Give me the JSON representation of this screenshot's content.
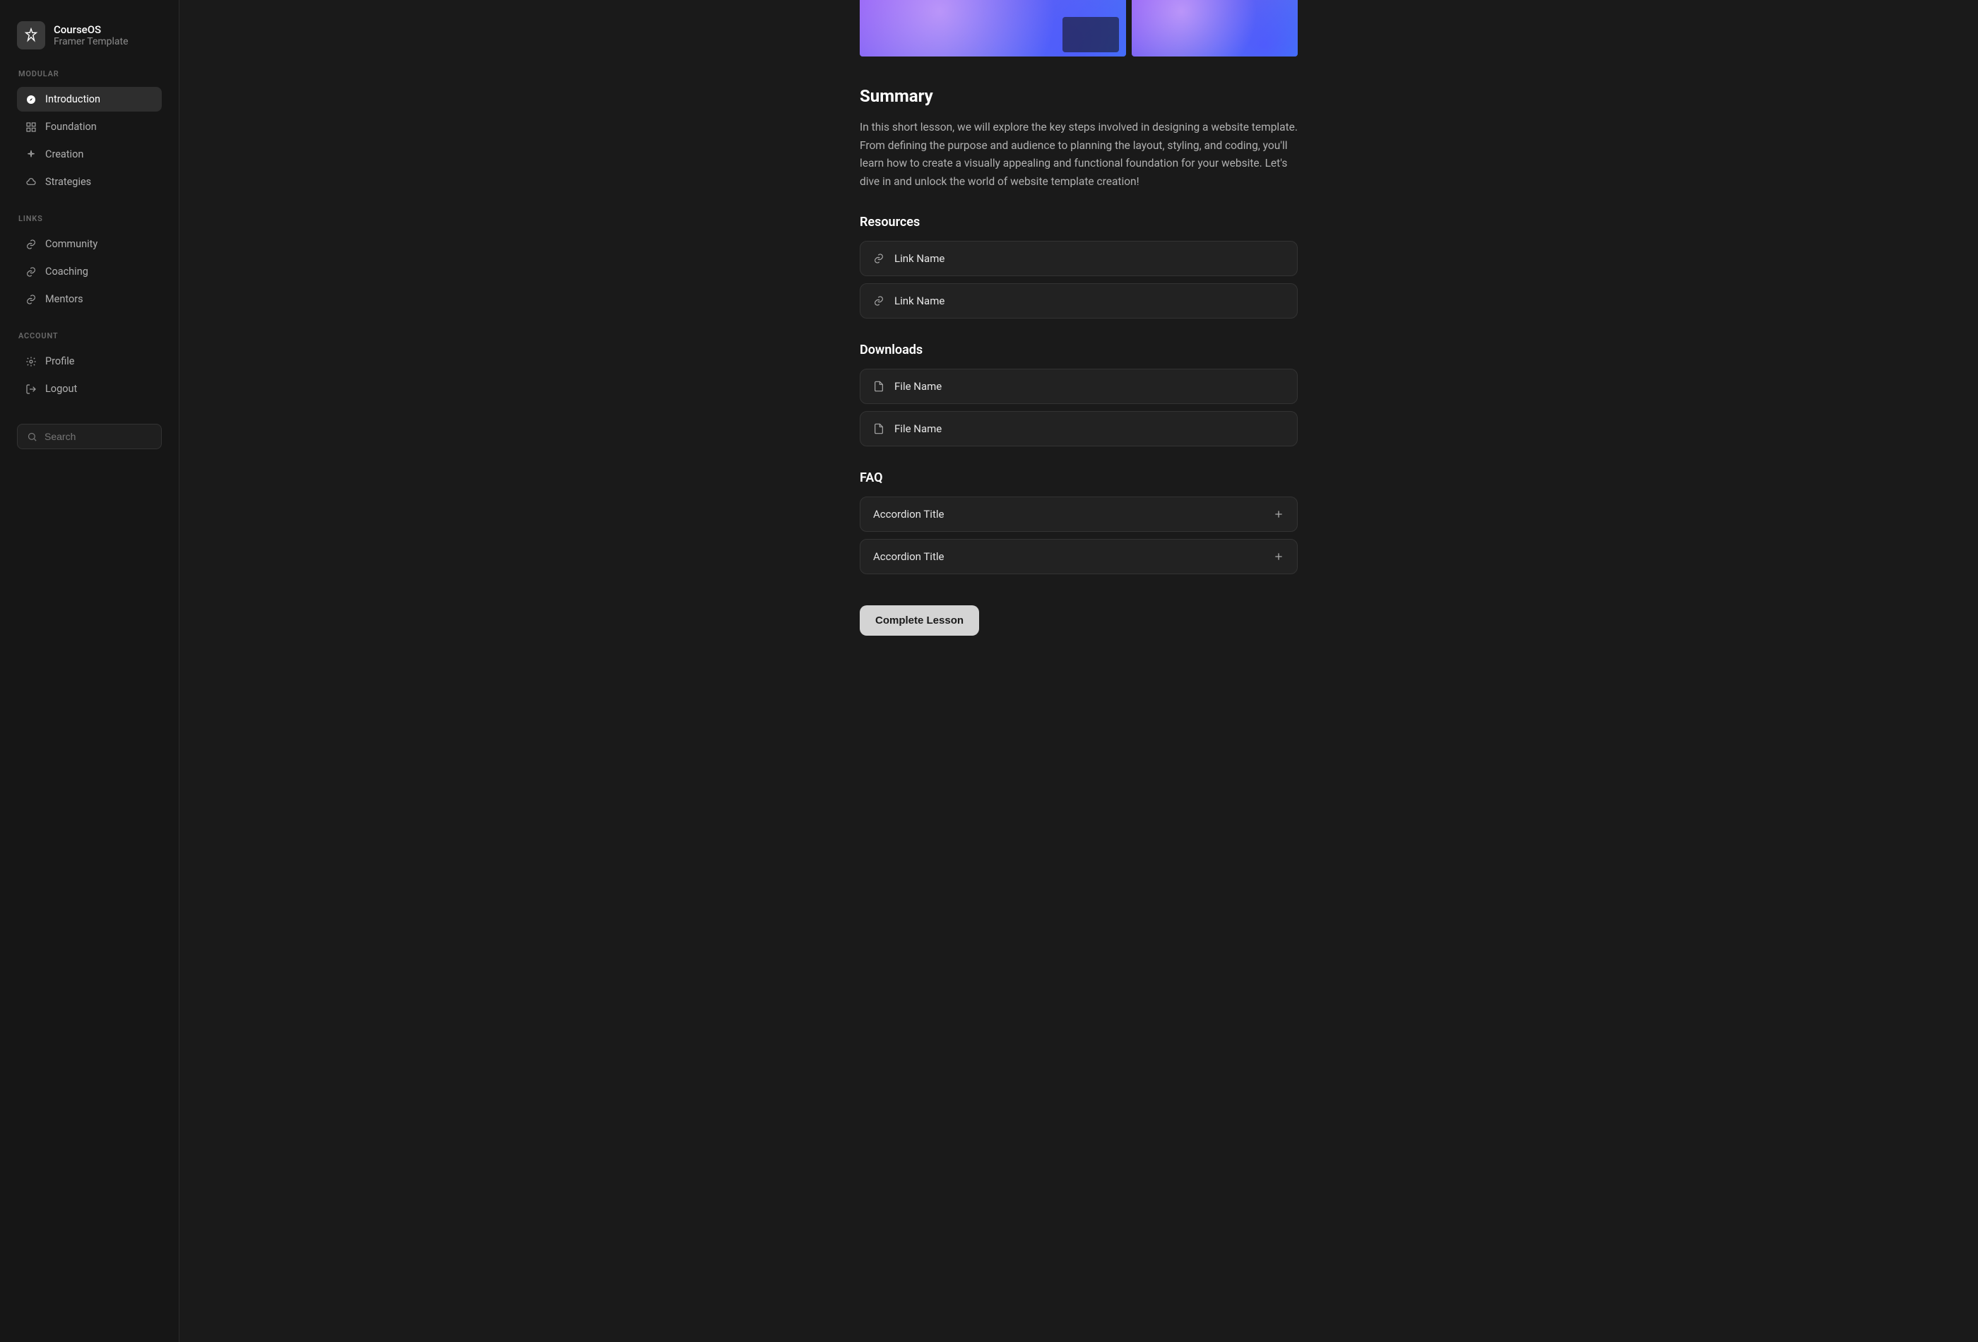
{
  "brand": {
    "title": "CourseOS",
    "subtitle": "Framer Template"
  },
  "sidebar": {
    "sections": [
      {
        "heading": "MODULAR",
        "items": [
          {
            "label": "Introduction",
            "icon": "compass",
            "active": true
          },
          {
            "label": "Foundation",
            "icon": "shapes",
            "active": false
          },
          {
            "label": "Creation",
            "icon": "sparkle",
            "active": false
          },
          {
            "label": "Strategies",
            "icon": "cloud",
            "active": false
          }
        ]
      },
      {
        "heading": "LINKS",
        "items": [
          {
            "label": "Community",
            "icon": "link",
            "active": false
          },
          {
            "label": "Coaching",
            "icon": "link",
            "active": false
          },
          {
            "label": "Mentors",
            "icon": "link",
            "active": false
          }
        ]
      },
      {
        "heading": "ACCOUNT",
        "items": [
          {
            "label": "Profile",
            "icon": "gear",
            "active": false
          },
          {
            "label": "Logout",
            "icon": "logout",
            "active": false
          }
        ]
      }
    ],
    "search_placeholder": "Search"
  },
  "content": {
    "summary_heading": "Summary",
    "summary_text": "In this short lesson, we will explore the key steps involved in designing a website template. From defining the purpose and audience to planning the layout, styling, and coding, you'll learn how to create a visually appealing and functional foundation for your website. Let's dive in and unlock the world of website template creation!",
    "resources_heading": "Resources",
    "resources": [
      {
        "label": "Link Name"
      },
      {
        "label": "Link Name"
      }
    ],
    "downloads_heading": "Downloads",
    "downloads": [
      {
        "label": "File Name"
      },
      {
        "label": "File Name"
      }
    ],
    "faq_heading": "FAQ",
    "faq": [
      {
        "title": "Accordion Title"
      },
      {
        "title": "Accordion Title"
      }
    ],
    "complete_button": "Complete Lesson"
  }
}
